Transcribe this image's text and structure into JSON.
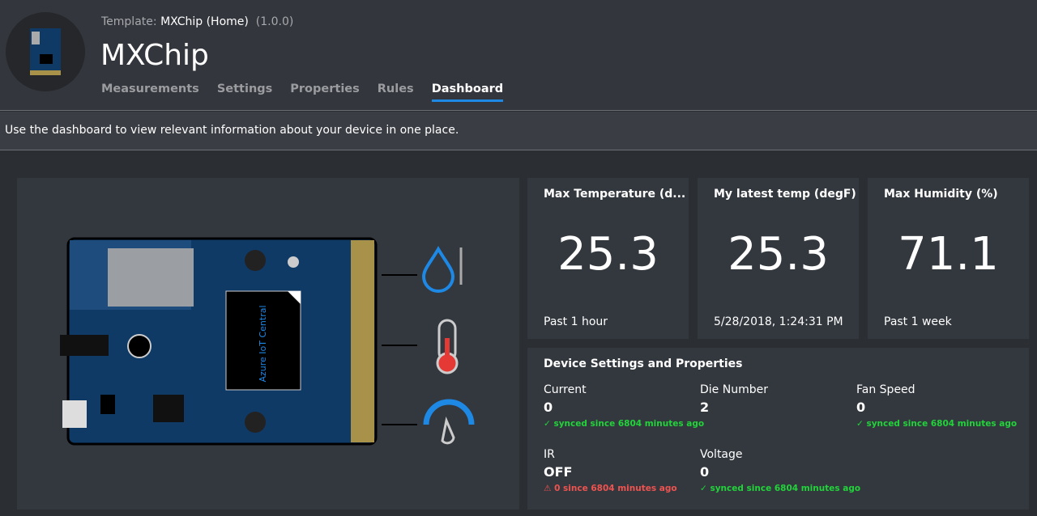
{
  "header": {
    "template_label": "Template:",
    "template_name": "MXChip (Home)",
    "version": "(1.0.0)",
    "title": "MXChip",
    "tabs": [
      {
        "label": "Measurements"
      },
      {
        "label": "Settings"
      },
      {
        "label": "Properties"
      },
      {
        "label": "Rules"
      },
      {
        "label": "Dashboard"
      }
    ],
    "active_tab": "Dashboard"
  },
  "description": "Use the dashboard to view relevant information about your device in one place.",
  "device_image": {
    "chip_label": "Azure IoT Central"
  },
  "kpis": [
    {
      "title": "Max Temperature (d...",
      "value": "25.3",
      "footer": "Past 1 hour"
    },
    {
      "title": "My latest temp (degF)",
      "value": "25.3",
      "footer": "5/28/2018, 1:24:31 PM"
    },
    {
      "title": "Max Humidity (%)",
      "value": "71.1",
      "footer": "Past 1 week"
    }
  ],
  "properties": {
    "title": "Device Settings and Properties",
    "items": [
      {
        "label": "Current",
        "value": "0",
        "status": "✓ synced since 6804 minutes ago"
      },
      {
        "label": "Die Number",
        "value": "2",
        "status": ""
      },
      {
        "label": "Fan Speed",
        "value": "0",
        "status": "✓ synced since 6804 minutes ago"
      },
      {
        "label": "IR",
        "value": "OFF",
        "status": "⚠ 0 since 6804 minutes ago"
      },
      {
        "label": "Voltage",
        "value": "0",
        "status": "✓ synced since 6804 minutes ago"
      }
    ]
  },
  "colors": {
    "accent": "#1e88e5",
    "synced": "#22d33a",
    "warning": "#ef5350",
    "board": "#0f3a66"
  }
}
